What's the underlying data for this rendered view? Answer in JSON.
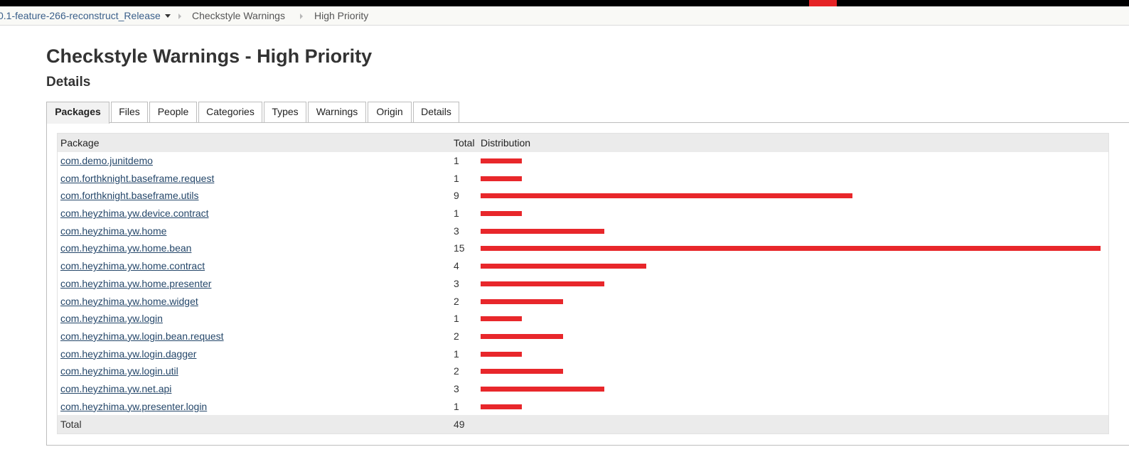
{
  "breadcrumb": {
    "job": "0.1-feature-266-reconstruct_Release",
    "warnings": "Checkstyle Warnings",
    "priority": "High Priority"
  },
  "page_title": "Checkstyle Warnings - High Priority",
  "section_title": "Details",
  "tabs": [
    {
      "label": "Packages",
      "active": true
    },
    {
      "label": "Files",
      "active": false
    },
    {
      "label": "People",
      "active": false
    },
    {
      "label": "Categories",
      "active": false
    },
    {
      "label": "Types",
      "active": false
    },
    {
      "label": "Warnings",
      "active": false
    },
    {
      "label": "Origin",
      "active": false
    },
    {
      "label": "Details",
      "active": false
    }
  ],
  "table": {
    "headers": {
      "package": "Package",
      "total": "Total",
      "distribution": "Distribution"
    },
    "max_total": 15,
    "bar_color": "#e8272b",
    "rows": [
      {
        "package": "com.demo.junitdemo",
        "total": 1
      },
      {
        "package": "com.forthknight.baseframe.request",
        "total": 1
      },
      {
        "package": "com.forthknight.baseframe.utils",
        "total": 9
      },
      {
        "package": "com.heyzhima.yw.device.contract",
        "total": 1
      },
      {
        "package": "com.heyzhima.yw.home",
        "total": 3
      },
      {
        "package": "com.heyzhima.yw.home.bean",
        "total": 15
      },
      {
        "package": "com.heyzhima.yw.home.contract",
        "total": 4
      },
      {
        "package": "com.heyzhima.yw.home.presenter",
        "total": 3
      },
      {
        "package": "com.heyzhima.yw.home.widget",
        "total": 2
      },
      {
        "package": "com.heyzhima.yw.login",
        "total": 1
      },
      {
        "package": "com.heyzhima.yw.login.bean.request",
        "total": 2
      },
      {
        "package": "com.heyzhima.yw.login.dagger",
        "total": 1
      },
      {
        "package": "com.heyzhima.yw.login.util",
        "total": 2
      },
      {
        "package": "com.heyzhima.yw.net.api",
        "total": 3
      },
      {
        "package": "com.heyzhima.yw.presenter.login",
        "total": 1
      }
    ],
    "footer": {
      "label": "Total",
      "total": "49"
    }
  }
}
